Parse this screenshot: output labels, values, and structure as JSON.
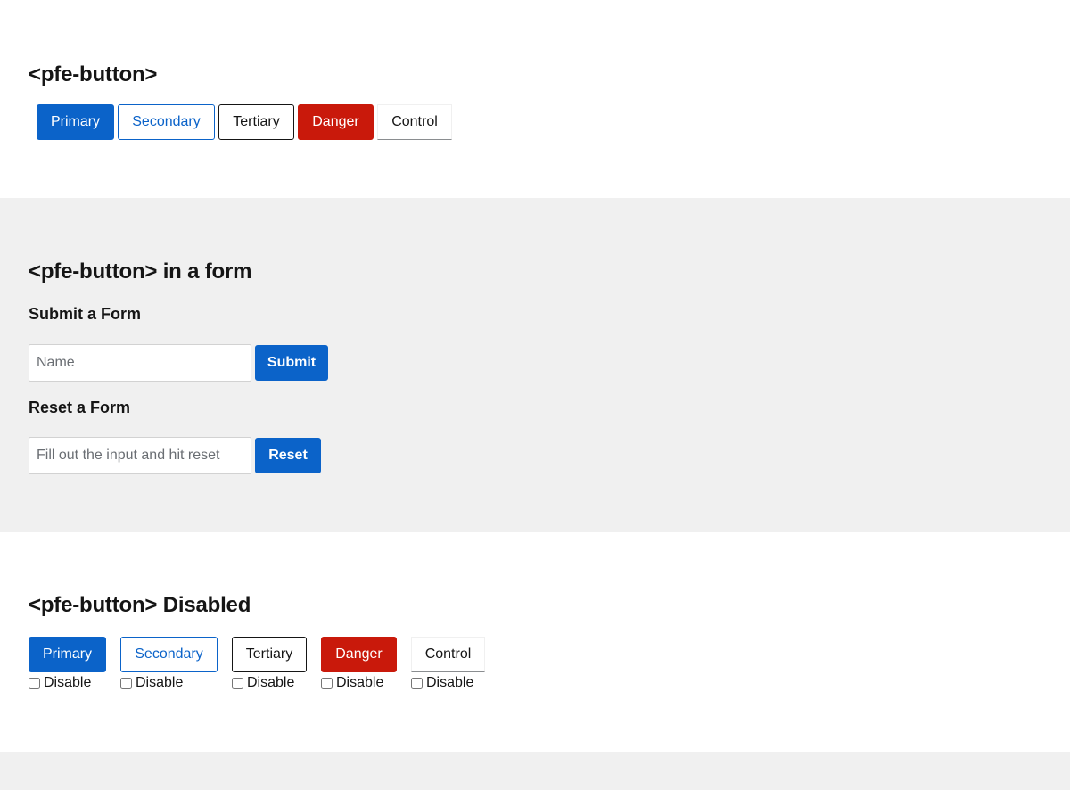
{
  "sections": {
    "basic": {
      "title": "<pfe-button>",
      "buttons": {
        "primary": "Primary",
        "secondary": "Secondary",
        "tertiary": "Tertiary",
        "danger": "Danger",
        "control": "Control"
      }
    },
    "form": {
      "title": "<pfe-button> in a form",
      "submit": {
        "heading": "Submit a Form",
        "input_placeholder": "Name",
        "input_value": "",
        "button": "Submit"
      },
      "reset": {
        "heading": "Reset a Form",
        "input_placeholder": "Fill out the input and hit reset",
        "input_value": "",
        "button": "Reset"
      }
    },
    "disabled": {
      "title": "<pfe-button> Disabled",
      "buttons": {
        "primary": "Primary",
        "secondary": "Secondary",
        "tertiary": "Tertiary",
        "danger": "Danger",
        "control": "Control"
      },
      "checkbox_label": "Disable",
      "checked": [
        false,
        false,
        false,
        false,
        false
      ]
    }
  },
  "colors": {
    "primary": "#0b63c9",
    "danger": "#c9190b",
    "band_background": "#f0f0f0",
    "text": "#151515"
  }
}
